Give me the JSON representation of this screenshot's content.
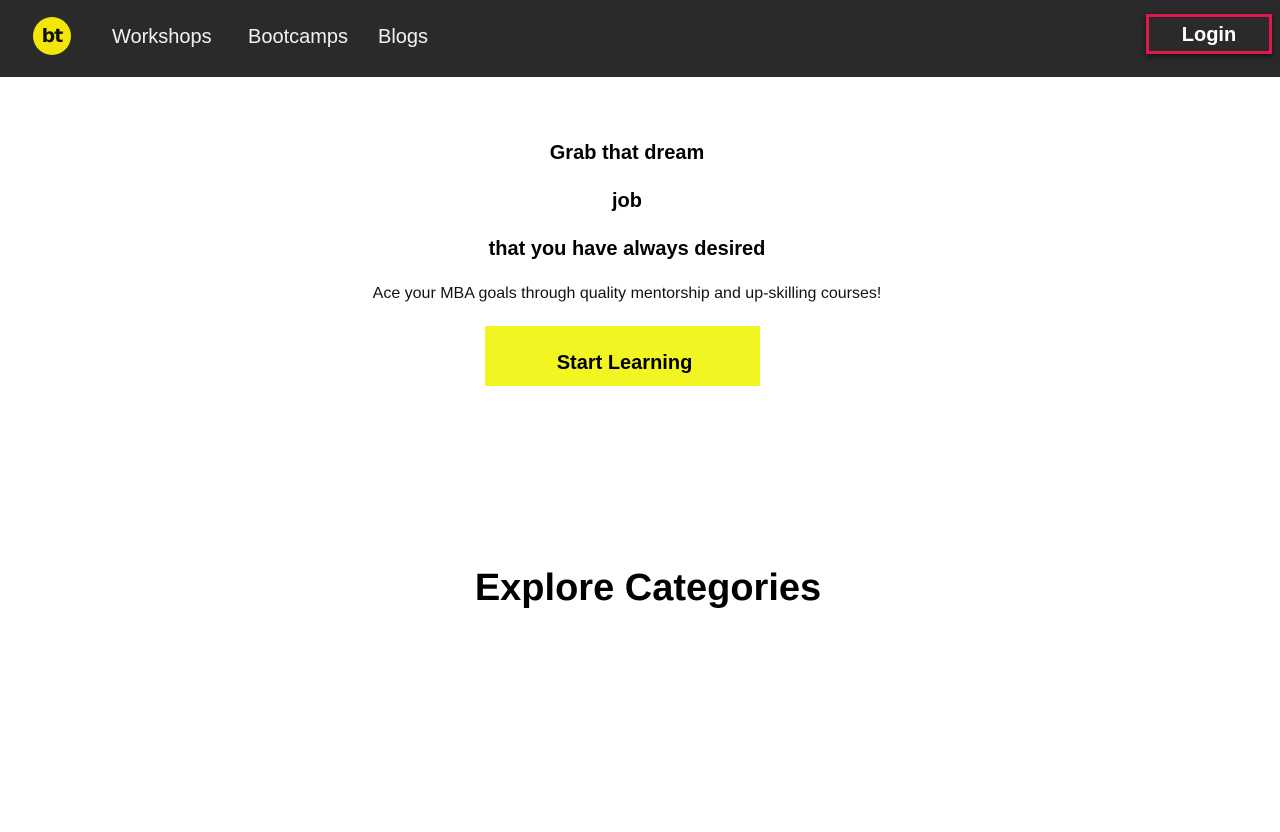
{
  "brand": {
    "logo_text": "bt",
    "logo_color": "#f5e60a"
  },
  "nav": {
    "links": [
      {
        "label": "Workshops"
      },
      {
        "label": "Bootcamps"
      },
      {
        "label": "Blogs"
      }
    ],
    "login_label": "Login",
    "background": "#2a2a2a",
    "login_border_color": "#e0174a"
  },
  "hero": {
    "lines": [
      "Grab that dream",
      "job",
      "that you have always desired"
    ],
    "subtitle": "Ace your MBA goals through quality mentorship and up-skilling courses!",
    "cta_label": "Start Learning",
    "cta_color": "#f1f522"
  },
  "categories": {
    "title": "Explore Categories"
  }
}
